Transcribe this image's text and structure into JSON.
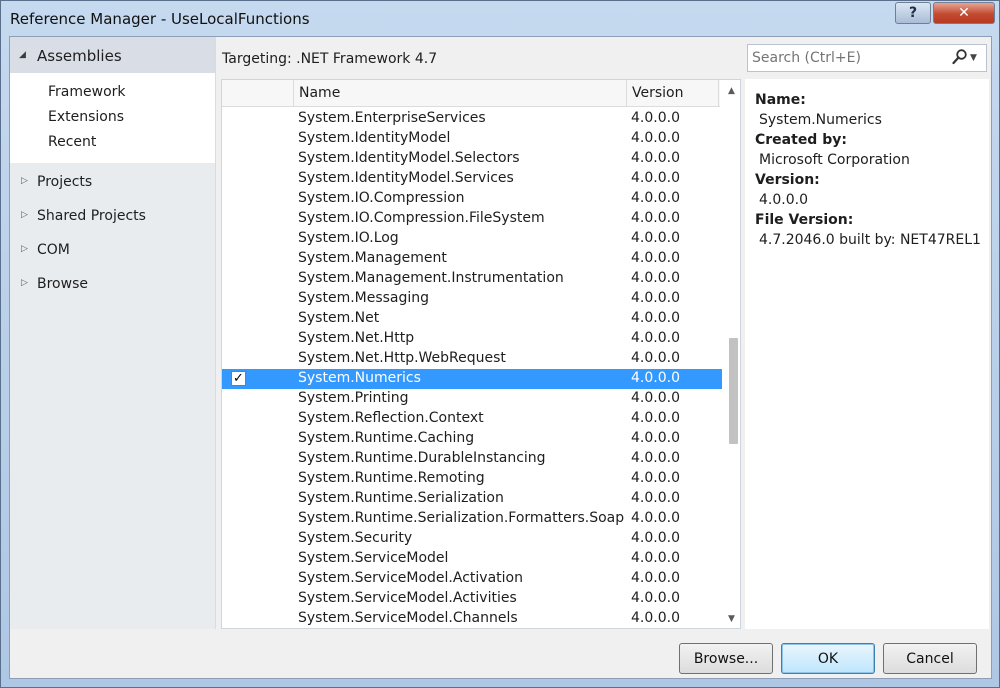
{
  "window": {
    "title": "Reference Manager - UseLocalFunctions",
    "help_label": "?",
    "close_label": "✕"
  },
  "nav": {
    "header": "Assemblies",
    "sub_items": [
      "Framework",
      "Extensions",
      "Recent"
    ],
    "categories": [
      "Projects",
      "Shared Projects",
      "COM",
      "Browse"
    ]
  },
  "targeting": "Targeting: .NET Framework 4.7",
  "search": {
    "placeholder": "Search (Ctrl+E)"
  },
  "list": {
    "columns": {
      "name": "Name",
      "version": "Version"
    },
    "rows": [
      {
        "name": "System.EnterpriseServices",
        "version": "4.0.0.0",
        "checked": false,
        "selected": false
      },
      {
        "name": "System.IdentityModel",
        "version": "4.0.0.0",
        "checked": false,
        "selected": false
      },
      {
        "name": "System.IdentityModel.Selectors",
        "version": "4.0.0.0",
        "checked": false,
        "selected": false
      },
      {
        "name": "System.IdentityModel.Services",
        "version": "4.0.0.0",
        "checked": false,
        "selected": false
      },
      {
        "name": "System.IO.Compression",
        "version": "4.0.0.0",
        "checked": false,
        "selected": false
      },
      {
        "name": "System.IO.Compression.FileSystem",
        "version": "4.0.0.0",
        "checked": false,
        "selected": false
      },
      {
        "name": "System.IO.Log",
        "version": "4.0.0.0",
        "checked": false,
        "selected": false
      },
      {
        "name": "System.Management",
        "version": "4.0.0.0",
        "checked": false,
        "selected": false
      },
      {
        "name": "System.Management.Instrumentation",
        "version": "4.0.0.0",
        "checked": false,
        "selected": false
      },
      {
        "name": "System.Messaging",
        "version": "4.0.0.0",
        "checked": false,
        "selected": false
      },
      {
        "name": "System.Net",
        "version": "4.0.0.0",
        "checked": false,
        "selected": false
      },
      {
        "name": "System.Net.Http",
        "version": "4.0.0.0",
        "checked": false,
        "selected": false
      },
      {
        "name": "System.Net.Http.WebRequest",
        "version": "4.0.0.0",
        "checked": false,
        "selected": false
      },
      {
        "name": "System.Numerics",
        "version": "4.0.0.0",
        "checked": true,
        "selected": true
      },
      {
        "name": "System.Printing",
        "version": "4.0.0.0",
        "checked": false,
        "selected": false
      },
      {
        "name": "System.Reflection.Context",
        "version": "4.0.0.0",
        "checked": false,
        "selected": false
      },
      {
        "name": "System.Runtime.Caching",
        "version": "4.0.0.0",
        "checked": false,
        "selected": false
      },
      {
        "name": "System.Runtime.DurableInstancing",
        "version": "4.0.0.0",
        "checked": false,
        "selected": false
      },
      {
        "name": "System.Runtime.Remoting",
        "version": "4.0.0.0",
        "checked": false,
        "selected": false
      },
      {
        "name": "System.Runtime.Serialization",
        "version": "4.0.0.0",
        "checked": false,
        "selected": false
      },
      {
        "name": "System.Runtime.Serialization.Formatters.Soap",
        "version": "4.0.0.0",
        "checked": false,
        "selected": false
      },
      {
        "name": "System.Security",
        "version": "4.0.0.0",
        "checked": false,
        "selected": false
      },
      {
        "name": "System.ServiceModel",
        "version": "4.0.0.0",
        "checked": false,
        "selected": false
      },
      {
        "name": "System.ServiceModel.Activation",
        "version": "4.0.0.0",
        "checked": false,
        "selected": false
      },
      {
        "name": "System.ServiceModel.Activities",
        "version": "4.0.0.0",
        "checked": false,
        "selected": false
      },
      {
        "name": "System.ServiceModel.Channels",
        "version": "4.0.0.0",
        "checked": false,
        "selected": false
      }
    ]
  },
  "details": {
    "name_label": "Name:",
    "name_value": "System.Numerics",
    "created_label": "Created by:",
    "created_value": "Microsoft Corporation",
    "version_label": "Version:",
    "version_value": "4.0.0.0",
    "file_version_label": "File Version:",
    "file_version_value": "4.7.2046.0 built by: NET47REL1"
  },
  "buttons": {
    "browse": "Browse...",
    "ok": "OK",
    "cancel": "Cancel"
  },
  "colors": {
    "selection": "#3399ff",
    "frame": "#b6cde6"
  }
}
